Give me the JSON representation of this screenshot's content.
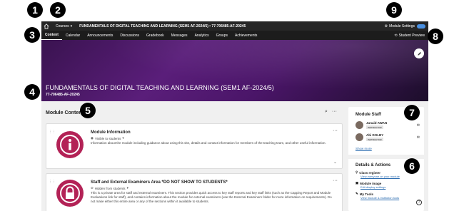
{
  "topbar": {
    "courses_label": "Courses",
    "course_title": "FUNDAMENTALS OF DIGITAL TEACHING AND LEARNING (SEM1 AF-2024/5) • 77-706485-AF-20245",
    "module_settings_label": "Module Settings"
  },
  "nav": {
    "tabs": [
      "Content",
      "Calendar",
      "Announcements",
      "Discussions",
      "Gradebook",
      "Messages",
      "Analytics",
      "Groups",
      "Achievements"
    ],
    "student_preview_label": "Student Preview"
  },
  "banner": {
    "title": "FUNDAMENTALS OF DIGITAL TEACHING AND LEARNING (SEM1 AF-2024/5)",
    "code": "77-706485-AF-20245"
  },
  "module_content": {
    "heading": "Module Content",
    "items": [
      {
        "title": "Module Information",
        "visibility": "Visible to students",
        "description": "Information about the module including guidance about using this site, details and contact information for members of the teaching team, and other useful information."
      },
      {
        "title": "Staff and External Examiners Area *DO NOT SHOW TO STUDENTS*",
        "visibility": "Hidden from students",
        "description": "This is a private area for staff and external examiners. This section provides quick access to key staff reports and key staff links (such as the Capping Report and Module Evaluations link for staff), and contains information about the module for external examiners (use the External Examiners folder for more information on requirements). Do not make either this entire area or any of the sections within it available to students."
      }
    ]
  },
  "sidebar": {
    "staff_heading": "Module Staff",
    "staff": [
      {
        "name": "Junaid AWAN",
        "role": "INSTRUCTOR"
      },
      {
        "name": "Abi DOLBY",
        "role": "INSTRUCTOR"
      }
    ],
    "show_more": "Show more",
    "details_heading": "Details & Actions",
    "details": [
      {
        "label": "Class register",
        "link": "View everyone on your module"
      },
      {
        "label": "Module image",
        "link": "Edit display settings"
      },
      {
        "label": "My Tools",
        "link": "View module & institution tools"
      }
    ]
  },
  "callouts": [
    "1",
    "2",
    "3",
    "4",
    "5",
    "6",
    "7",
    "8",
    "9"
  ],
  "colors": {
    "topbar": "#262626",
    "navbar": "#1c1c1c",
    "banner": "#4a1568",
    "module_icon": "#b32256",
    "link": "#2b6cb0"
  }
}
